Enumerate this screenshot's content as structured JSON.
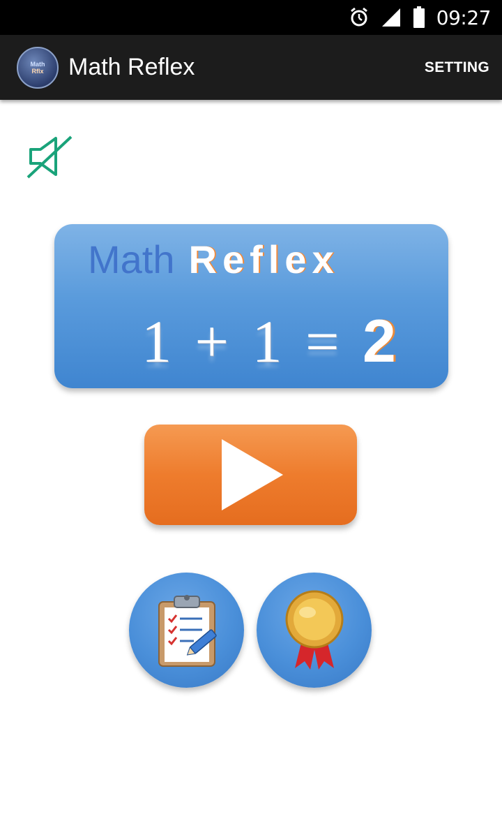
{
  "status_bar": {
    "time": "09:27",
    "icons": [
      "alarm-icon",
      "signal-icon",
      "battery-icon"
    ]
  },
  "app_bar": {
    "title": "Math Reflex",
    "logo_icon": "math-reflex-logo-icon",
    "setting_label": "SETTING"
  },
  "sound": {
    "icon": "speaker-muted-icon",
    "color": "#1aa37a"
  },
  "banner": {
    "word_math": "Math",
    "word_reflex": "Reflex",
    "equation": "1 + 1 =",
    "answer": "2"
  },
  "buttons": {
    "play_icon": "play-icon",
    "scores_icon": "clipboard-icon",
    "achievements_icon": "medal-icon"
  },
  "colors": {
    "banner": "#5a9bdc",
    "play": "#ee7c2d",
    "round": "#4a8fd9",
    "app_bar": "#1c1c1c"
  }
}
